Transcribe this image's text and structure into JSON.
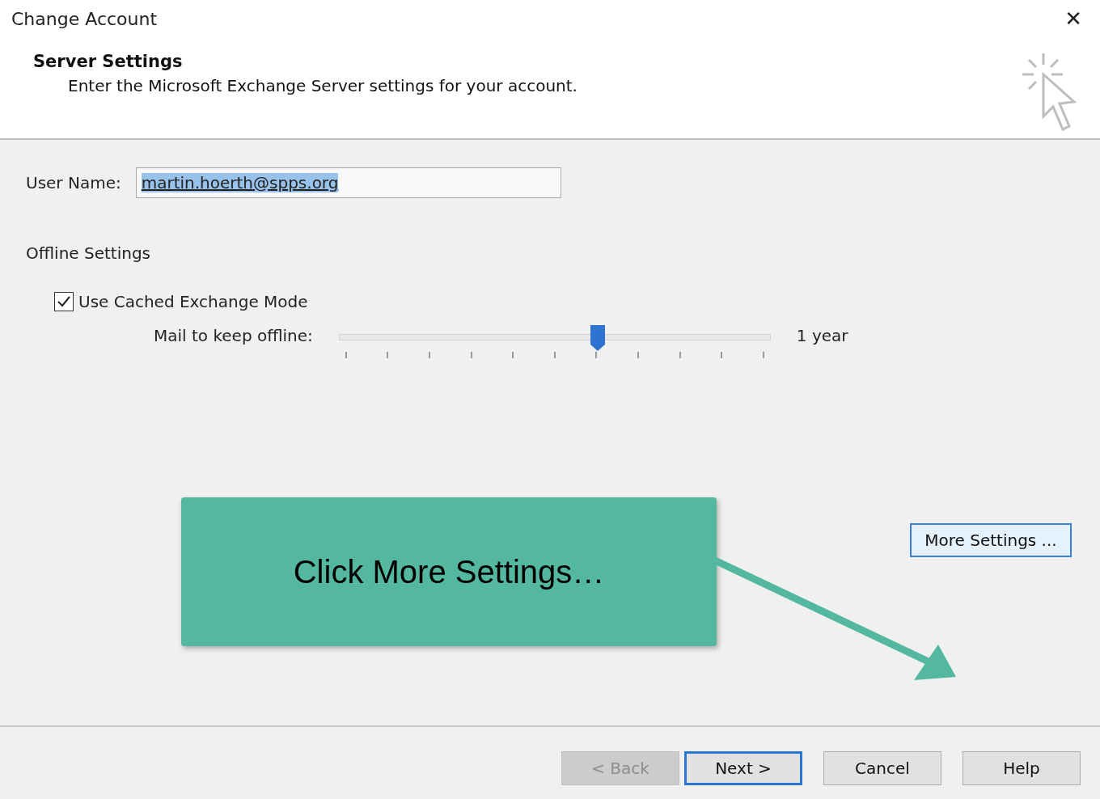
{
  "window": {
    "title": "Change Account",
    "close": "✕"
  },
  "header": {
    "title": "Server Settings",
    "subtitle": "Enter the Microsoft Exchange Server settings for your account."
  },
  "user_name": {
    "label": "User Name:",
    "value": "martin.hoerth@spps.org",
    "text_selected": true
  },
  "offline": {
    "heading": "Offline Settings",
    "cached_mode": {
      "label": "Use Cached Exchange Mode",
      "checked": true
    },
    "slider": {
      "label": "Mail to keep offline:",
      "level": 0.6,
      "reading": "1 year"
    }
  },
  "more_settings": {
    "label": "More Settings ..."
  },
  "callout": {
    "text": "Click More Settings…"
  },
  "buttons": [
    {
      "label": "< Back",
      "disabled": true,
      "default": false
    },
    {
      "label": "Next >",
      "disabled": false,
      "default": true
    },
    {
      "label": "Cancel",
      "disabled": false,
      "default": false
    },
    {
      "label": "Help",
      "disabled": false,
      "default": false
    }
  ]
}
